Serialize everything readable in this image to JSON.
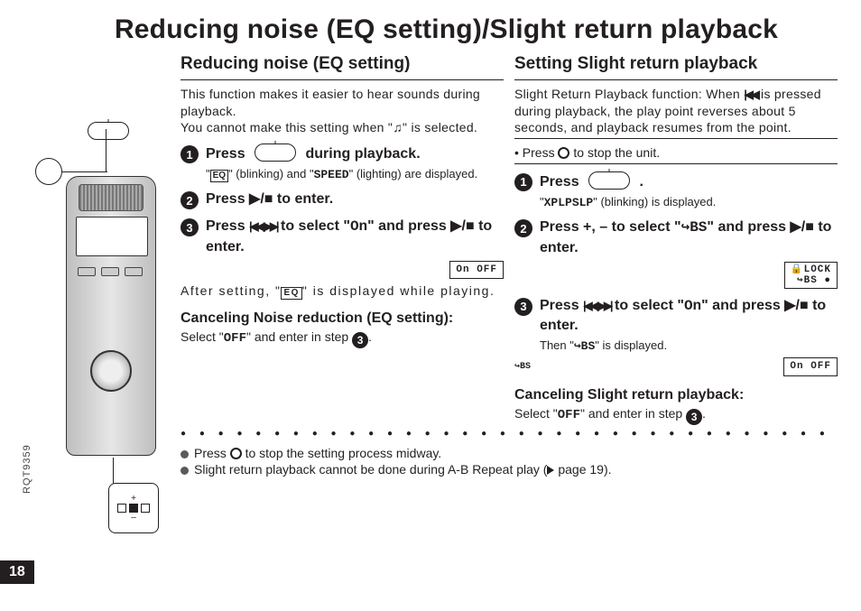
{
  "page_number": "18",
  "side_code": "RQT9359",
  "main_title": "Reducing noise (EQ setting)/Slight return playback",
  "left": {
    "heading": "Reducing noise (EQ setting)",
    "intro1": "This function makes it easier to hear sounds during playback.",
    "intro2a": "You cannot make this setting when \"",
    "intro2b": "\" is selected.",
    "s1_head_a": "Press",
    "s1_head_b": "during playback.",
    "s1_sub_a": "\"",
    "s1_sub_b": "\" (blinking) and \"",
    "s1_sub_c": "\" (lighting) are displayed.",
    "s2_head": "Press ▶/■ to enter.",
    "s3_head_a": "Press ",
    "s3_head_b": " to select \"",
    "s3_head_c": "\" and press ▶/■ to enter.",
    "lcd1": "On  OFF",
    "after_a": "After setting, \"",
    "after_b": "\" is displayed while playing.",
    "cancel_head": "Canceling Noise reduction (EQ setting):",
    "cancel_a": "Select \"",
    "cancel_b": "\" and enter in step ",
    "cancel_c": "."
  },
  "right": {
    "heading": "Setting Slight return playback",
    "intro_a": "Slight Return Playback function: When ",
    "intro_b": " is pressed during playback, the play point reverses about 5 seconds, and playback resumes from the point.",
    "pre_a": "Press ",
    "pre_b": " to stop the unit.",
    "s1_head": "Press",
    "s1_head_b": ".",
    "s1_sub_a": "\"",
    "s1_sub_b": "\" (blinking) is displayed.",
    "s2_head_a": "Press +, – to select \"",
    "s2_head_b": "\" and press ▶/■ to enter.",
    "lcd2_top": "🔒LOCK",
    "lcd2_bot": "↪BS ●",
    "s3_head_a": "Press ",
    "s3_head_b": " to select \"",
    "s3_head_c": "\" and press ▶/■ to enter.",
    "s3_sub_a": "Then \"",
    "s3_sub_b": "\" is displayed.",
    "lcd3_side": "↪BS",
    "lcd3": "On  OFF",
    "cancel_head": "Canceling Slight return playback:",
    "cancel_a": "Select \"",
    "cancel_b": "\" and enter in step ",
    "cancel_c": "."
  },
  "notes": {
    "n1_a": "Press ",
    "n1_b": " to stop the setting process midway.",
    "n2_a": "Slight return playback cannot be done during A-B Repeat play (",
    "n2_b": " page 19)."
  },
  "glyphs": {
    "eq": "EQ",
    "speed": "SPEED",
    "headphone": "♫",
    "on": "On",
    "off": "OFF",
    "xplpslp": "XPLPSLP",
    "bs": "↪BS",
    "rew": "|◀◀",
    "fwd": "▶▶|",
    "rewfwd": "|◀◀, ▶▶|"
  }
}
